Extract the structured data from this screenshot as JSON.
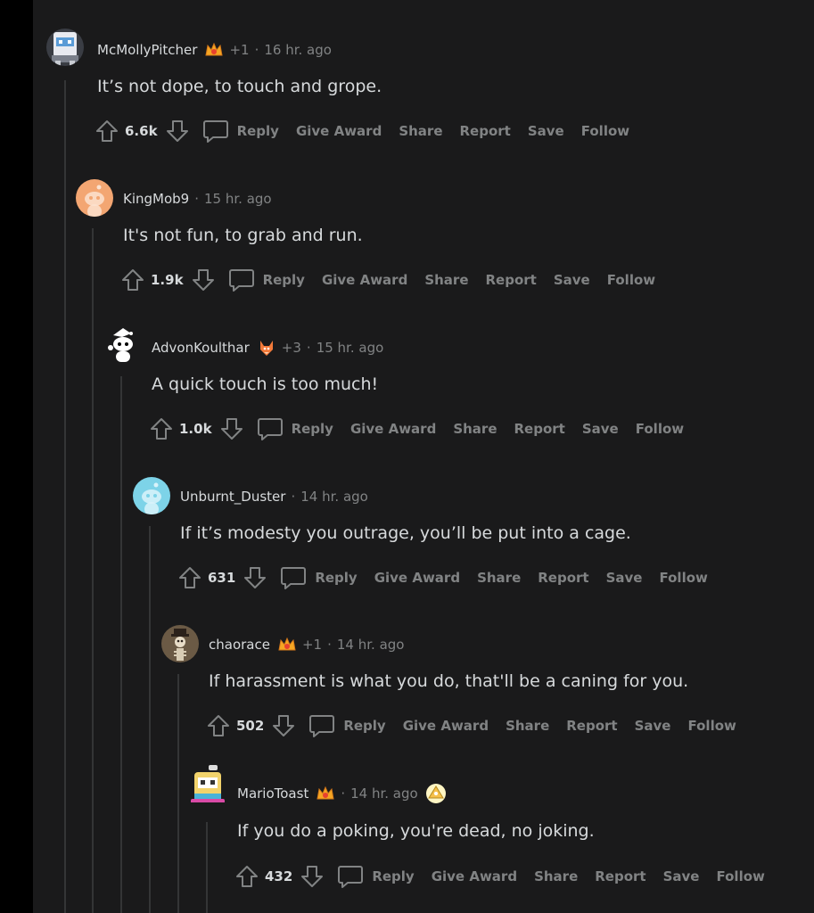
{
  "comments": [
    {
      "author": "McMollyPitcher",
      "has_award": true,
      "plus": "+1",
      "time": "16 hr. ago",
      "text": "It’s not dope, to touch and grope.",
      "score": "6.6k",
      "avatar_icon": "robot-avatar-icon"
    },
    {
      "author": "KingMob9",
      "has_award": false,
      "plus": "",
      "time": "15 hr. ago",
      "text": "It's not fun, to grab and run.",
      "score": "1.9k",
      "avatar_icon": "default-orange-avatar-icon"
    },
    {
      "author": "AdvonKoulthar",
      "has_award": true,
      "plus": "+3",
      "time": "15 hr. ago",
      "text": "A quick touch is too much!",
      "score": "1.0k",
      "avatar_icon": "snoo-avatar-icon"
    },
    {
      "author": "Unburnt_Duster",
      "has_award": false,
      "plus": "",
      "time": "14 hr. ago",
      "text": "If it’s modesty you outrage, you’ll be put into a cage.",
      "score": "631",
      "avatar_icon": "default-teal-avatar-icon"
    },
    {
      "author": "chaorace",
      "has_award": true,
      "plus": "+1",
      "time": "14 hr. ago",
      "text": "If harassment is what you do, that'll be a caning for you.",
      "score": "502",
      "avatar_icon": "skeleton-avatar-icon"
    },
    {
      "author": "MarioToast",
      "has_award": true,
      "plus": "",
      "time": "14 hr. ago",
      "text": "If you do a poking, you're dead, no joking.",
      "score": "432",
      "avatar_icon": "toaster-avatar-icon"
    }
  ],
  "actions": {
    "reply": "Reply",
    "give_award": "Give Award",
    "share": "Share",
    "report": "Report",
    "save": "Save",
    "follow": "Follow"
  },
  "colors": {
    "background": "#1a1a1b",
    "outer": "#000000",
    "text": "#d7dadc",
    "muted": "#818384",
    "thread_line": "#343536"
  }
}
